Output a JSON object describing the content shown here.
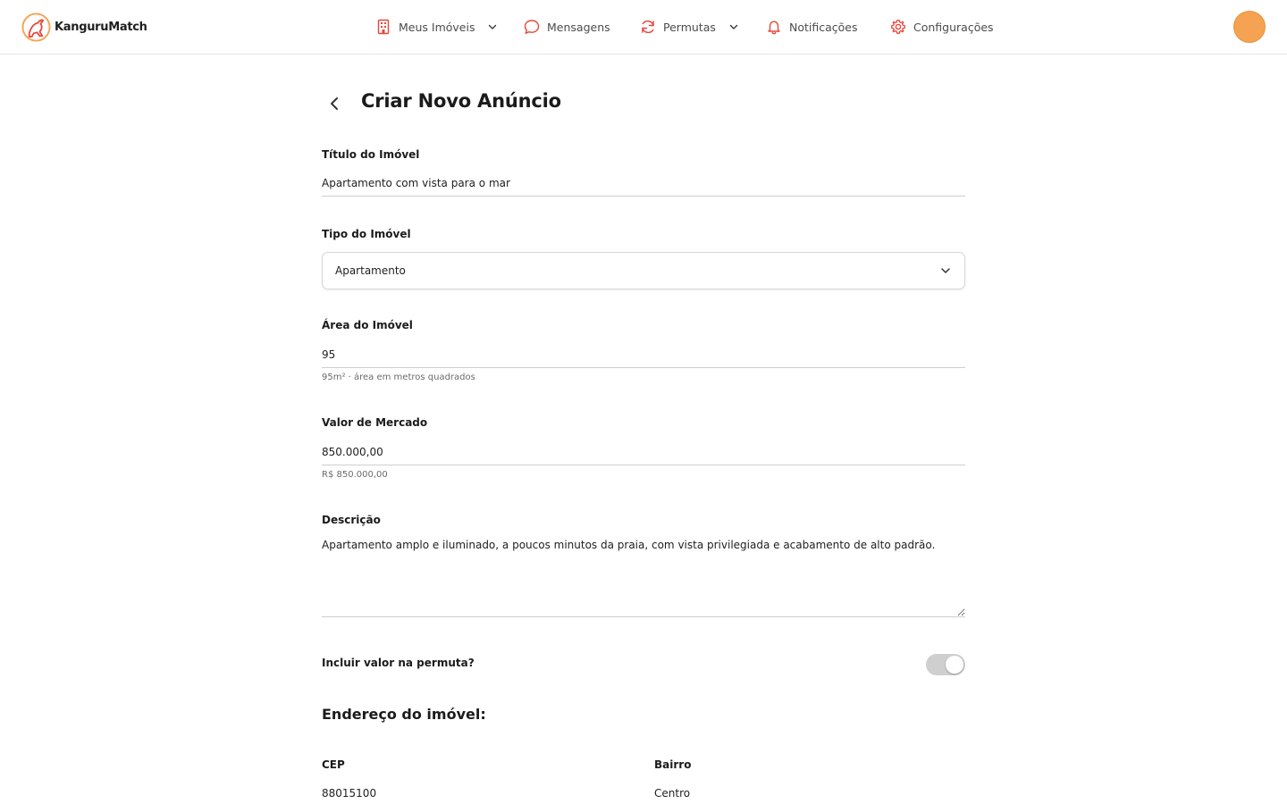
{
  "brand": {
    "name": "KanguruMatch",
    "accent": "#e8463a",
    "orange": "#f5a352"
  },
  "nav": {
    "items": [
      {
        "label": "Meus Imóveis",
        "icon": "building-icon",
        "has_dropdown": true
      },
      {
        "label": "Mensagens",
        "icon": "chat-bubble-icon",
        "has_dropdown": false
      },
      {
        "label": "Permutas",
        "icon": "refresh-icon",
        "has_dropdown": true
      },
      {
        "label": "Notificações",
        "icon": "bell-icon",
        "has_dropdown": false
      },
      {
        "label": "Configurações",
        "icon": "gear-icon",
        "has_dropdown": false
      }
    ]
  },
  "page": {
    "title": "Criar Novo Anúncio"
  },
  "form": {
    "titulo": {
      "label": "Título do Imóvel",
      "value": "Apartamento com vista para o mar"
    },
    "tipo": {
      "label": "Tipo do Imóvel",
      "value": "Apartamento"
    },
    "area": {
      "label": "Área do Imóvel",
      "value": "95",
      "hint": "95m² · área em metros quadrados"
    },
    "valor": {
      "label": "Valor de Mercado",
      "value": "850.000,00",
      "hint": "R$ 850.000,00"
    },
    "descricao": {
      "label": "Descrição",
      "value": "Apartamento amplo e iluminado, a poucos minutos da praia, com vista privilegiada e acabamento de alto padrão."
    },
    "incluir_valor": {
      "label": "Incluir valor na permuta?",
      "checked": false
    }
  },
  "endereco": {
    "title": "Endereço do imóvel:",
    "cep": {
      "label": "CEP",
      "value": "88015100"
    },
    "bairro": {
      "label": "Bairro",
      "value": "Centro"
    }
  }
}
